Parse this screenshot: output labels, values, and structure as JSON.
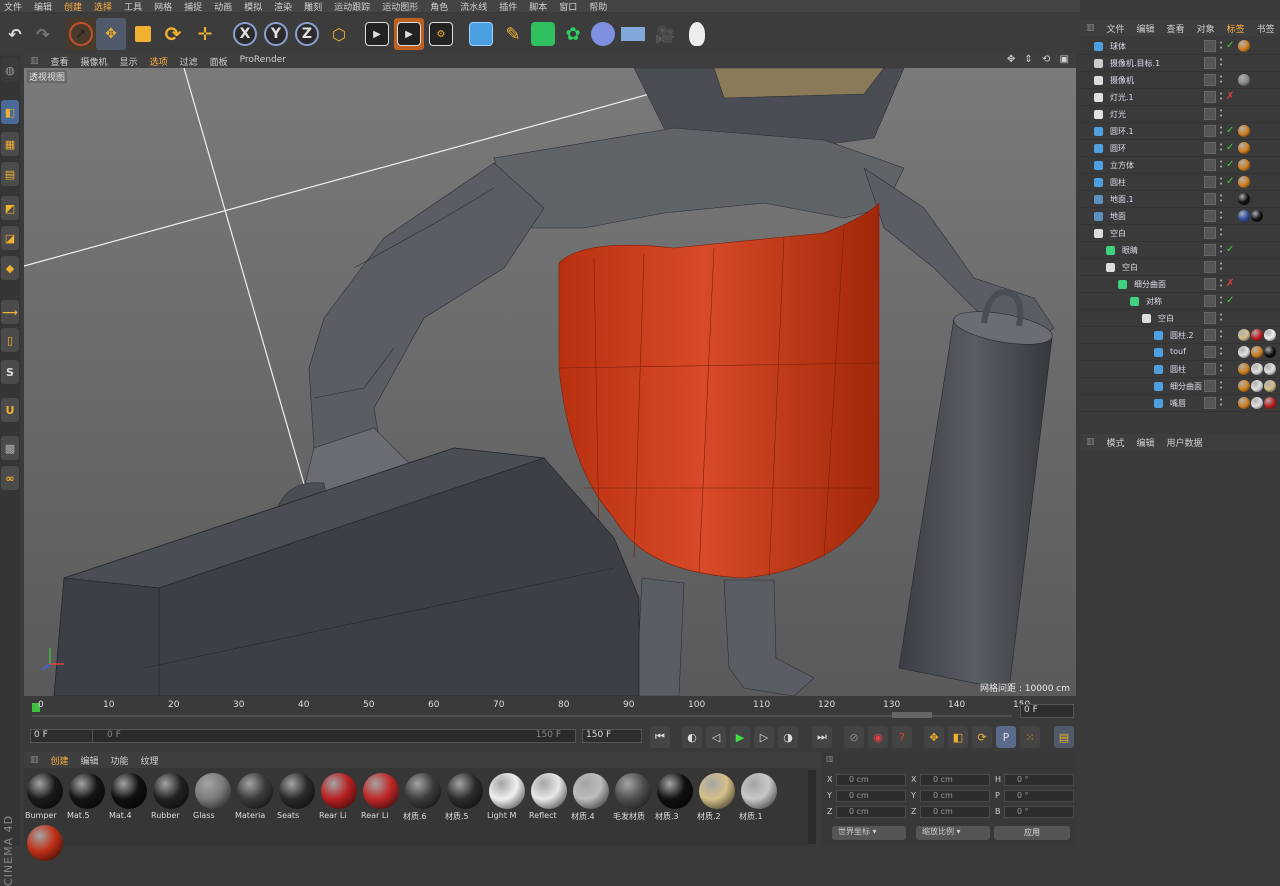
{
  "menubar": [
    "文件",
    "编辑",
    "创建",
    "选择",
    "工具",
    "网格",
    "捕捉",
    "动画",
    "模拟",
    "渲染",
    "雕刻",
    "运动跟踪",
    "运动图形",
    "角色",
    "流水线",
    "插件",
    "脚本",
    "窗口",
    "帮助"
  ],
  "toolbar": {
    "undo_icon": "undo-icon",
    "axes": [
      "X",
      "Y",
      "Z"
    ]
  },
  "viewport": {
    "menu": [
      "查看",
      "摄像机",
      "显示",
      "选项",
      "过滤",
      "面板",
      "ProRender"
    ],
    "label": "透视视图",
    "grid_label": "网格间距 : 10000 cm"
  },
  "timeline": {
    "ticks": [
      "0",
      "10",
      "20",
      "30",
      "40",
      "50",
      "60",
      "70",
      "80",
      "90",
      "100",
      "110",
      "120",
      "130",
      "140",
      "150"
    ],
    "current_frame": "0 F"
  },
  "transport": {
    "start": "0 F",
    "range_start": "0 F",
    "range_end": "150 F",
    "end": "150 F"
  },
  "materials": {
    "menu": [
      "创建",
      "编辑",
      "功能",
      "纹理"
    ],
    "items": [
      {
        "name": "Bumper",
        "color": "#1a1a1a"
      },
      {
        "name": "Mat.5",
        "color": "#141414"
      },
      {
        "name": "Mat.4",
        "color": "#101010"
      },
      {
        "name": "Rubber",
        "color": "#222222"
      },
      {
        "name": "Glass",
        "color": "#7a7a7a"
      },
      {
        "name": "Materia",
        "color": "#3a3a3a"
      },
      {
        "name": "Seats",
        "color": "#2a2a2a"
      },
      {
        "name": "Rear Li",
        "color": "#b82020"
      },
      {
        "name": "Rear Li",
        "color": "#c02828"
      },
      {
        "name": "材质.6",
        "color": "#3c3c3c"
      },
      {
        "name": "材质.5",
        "color": "#2c2c2c"
      },
      {
        "name": "Light M",
        "color": "#f0f0f0"
      },
      {
        "name": "Reflect",
        "color": "#e8e8e8"
      },
      {
        "name": "材质.4",
        "color": "#bcbcbc"
      },
      {
        "name": "毛发材质",
        "color": "#505050"
      },
      {
        "name": "材质.3",
        "color": "#101010"
      },
      {
        "name": "材质.2",
        "color": "#d4c08a"
      },
      {
        "name": "材质.1",
        "color": "#c8c8c8"
      },
      {
        "name": "",
        "color": "#c03018"
      }
    ]
  },
  "coords": {
    "rows": [
      {
        "a": "X",
        "av": "0 cm",
        "b": "X",
        "bv": "0 cm",
        "c": "H",
        "cv": "0 °"
      },
      {
        "a": "Y",
        "av": "0 cm",
        "b": "Y",
        "bv": "0 cm",
        "c": "P",
        "cv": "0 °"
      },
      {
        "a": "Z",
        "av": "0 cm",
        "b": "Z",
        "bv": "0 cm",
        "c": "B",
        "cv": "0 °"
      }
    ],
    "world": "世界坐标",
    "scale": "缩放比例",
    "apply": "应用"
  },
  "object_manager": {
    "menu": [
      "文件",
      "编辑",
      "查看",
      "对象",
      "标签",
      "书签"
    ],
    "objects": [
      {
        "name": "球体",
        "depth": 0,
        "icon": "sphere-icon",
        "color": "#4fa0e0",
        "status": "✓",
        "tags": [
          "#d08020"
        ]
      },
      {
        "name": "摄像机.目标.1",
        "depth": 0,
        "icon": "camera-target-icon",
        "color": "#cccccc",
        "status": "",
        "tags": []
      },
      {
        "name": "摄像机",
        "depth": 0,
        "icon": "camera-icon",
        "color": "#dddddd",
        "status": "",
        "tags": [
          "#888888"
        ]
      },
      {
        "name": "灯光.1",
        "depth": 0,
        "icon": "light-icon",
        "color": "#e0e0e0",
        "status": "✗",
        "tags": []
      },
      {
        "name": "灯光",
        "depth": 0,
        "icon": "light-icon",
        "color": "#e0e0e0",
        "status": "",
        "tags": []
      },
      {
        "name": "圆环.1",
        "depth": 0,
        "icon": "torus-icon",
        "color": "#4fa0e0",
        "status": "✓",
        "tags": [
          "#d08020"
        ]
      },
      {
        "name": "圆环",
        "depth": 0,
        "icon": "torus-icon",
        "color": "#4fa0e0",
        "status": "✓",
        "tags": [
          "#d08020"
        ]
      },
      {
        "name": "立方体",
        "depth": 0,
        "icon": "cube-icon",
        "color": "#4fa0e0",
        "status": "✓",
        "tags": [
          "#d08020"
        ]
      },
      {
        "name": "圆柱",
        "depth": 0,
        "icon": "cylinder-icon",
        "color": "#4fa0e0",
        "status": "✓",
        "tags": [
          "#d08020"
        ]
      },
      {
        "name": "地面.1",
        "depth": 0,
        "icon": "floor-icon",
        "color": "#6090c0",
        "status": "",
        "tags": [
          "#111111"
        ]
      },
      {
        "name": "地面",
        "depth": 0,
        "icon": "floor-icon",
        "color": "#6090c0",
        "status": "",
        "tags": [
          "#3050a0",
          "#111111"
        ]
      },
      {
        "name": "空白",
        "depth": 0,
        "icon": "null-icon",
        "color": "#dddddd",
        "status": "",
        "tags": []
      },
      {
        "name": "眼睛",
        "depth": 1,
        "icon": "symmetry-icon",
        "color": "#40d080",
        "status": "✓",
        "tags": []
      },
      {
        "name": "空白",
        "depth": 1,
        "icon": "null-icon",
        "color": "#dddddd",
        "status": "",
        "tags": []
      },
      {
        "name": "细分曲面",
        "depth": 2,
        "icon": "subdivision-icon",
        "color": "#40d080",
        "status": "✗",
        "tags": []
      },
      {
        "name": "对称",
        "depth": 3,
        "icon": "symmetry-icon",
        "color": "#40d080",
        "status": "✓",
        "tags": []
      },
      {
        "name": "空白",
        "depth": 4,
        "icon": "null-icon",
        "color": "#dddddd",
        "status": "",
        "tags": []
      },
      {
        "name": "圆柱.2",
        "depth": 5,
        "icon": "polygon-icon",
        "color": "#4fa0e0",
        "status": "",
        "tags": [
          "#d4c08a",
          "#c02020",
          "#f0f0f0"
        ]
      },
      {
        "name": "touf",
        "depth": 5,
        "icon": "polygon-icon",
        "color": "#4fa0e0",
        "status": "",
        "tags": [
          "#e0e0e0",
          "#d08020",
          "#111111"
        ]
      },
      {
        "name": "圆柱",
        "depth": 5,
        "icon": "polygon-icon",
        "color": "#4fa0e0",
        "status": "",
        "tags": [
          "#d08020",
          "#e0e0e0",
          "#e0e0e0"
        ]
      },
      {
        "name": "细分曲面",
        "depth": 5,
        "icon": "polygon-icon",
        "color": "#4fa0e0",
        "status": "",
        "tags": [
          "#d08020",
          "#e0e0e0",
          "#d4c08a"
        ]
      },
      {
        "name": "嘴唇",
        "depth": 5,
        "icon": "polygon-icon",
        "color": "#4fa0e0",
        "status": "",
        "tags": [
          "#d08020",
          "#e0e0e0",
          "#c02020"
        ]
      }
    ]
  },
  "attributes": {
    "menu": [
      "模式",
      "编辑",
      "用户数据"
    ]
  },
  "app_name": "CINEMA 4D"
}
